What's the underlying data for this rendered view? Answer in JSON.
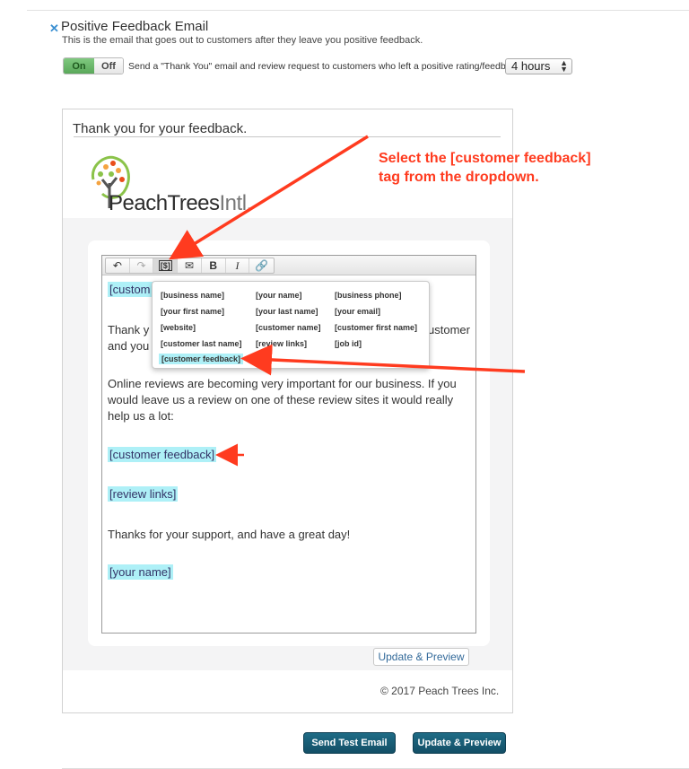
{
  "section": {
    "title": "Positive Feedback Email",
    "description": "This is the email that goes out to customers after they leave you positive feedback.",
    "toggle_on": "On",
    "toggle_off": "Off",
    "send_text": "Send a \"Thank You\" email and review request to customers who left a positive rating/feedback in:",
    "hours_value": "4 hours"
  },
  "email": {
    "subject": "Thank you for your feedback.",
    "logo_main": "PeachTrees",
    "logo_light": "Intl.",
    "tag_customer_partial": "[custom",
    "line1_start": "Thank y",
    "line1_end": "ustomer",
    "line2_start": "and you",
    "paragraph": "Online reviews are becoming very important for our business. If you would leave us a review on one of these review sites it would really help us a lot:",
    "tag_customer_feedback": "[customer feedback]",
    "tag_review_links": "[review links]",
    "thanks": "Thanks for your support, and have a great day!",
    "tag_your_name": "[your name]",
    "update_preview_small": "Update & Preview",
    "copyright": "© 2017 Peach Trees Inc."
  },
  "dropdown": {
    "items": [
      "[business name]",
      "[your name]",
      "[business phone]",
      "[your first name]",
      "[your last name]",
      "[your email]",
      "[website]",
      "[customer name]",
      "[customer first name]",
      "[customer last name]",
      "[review links]",
      "[job id]",
      "[customer feedback]"
    ]
  },
  "annotation": {
    "line1": "Select the [customer feedback]",
    "line2": "tag from the dropdown."
  },
  "buttons": {
    "send_test": "Send Test Email",
    "update_preview": "Update & Preview"
  },
  "colors": {
    "accent": "#1a5f7a",
    "toggle_on": "#5cb85c",
    "tag_highlight": "#aef0f7",
    "annotation": "#ff3b1f"
  }
}
